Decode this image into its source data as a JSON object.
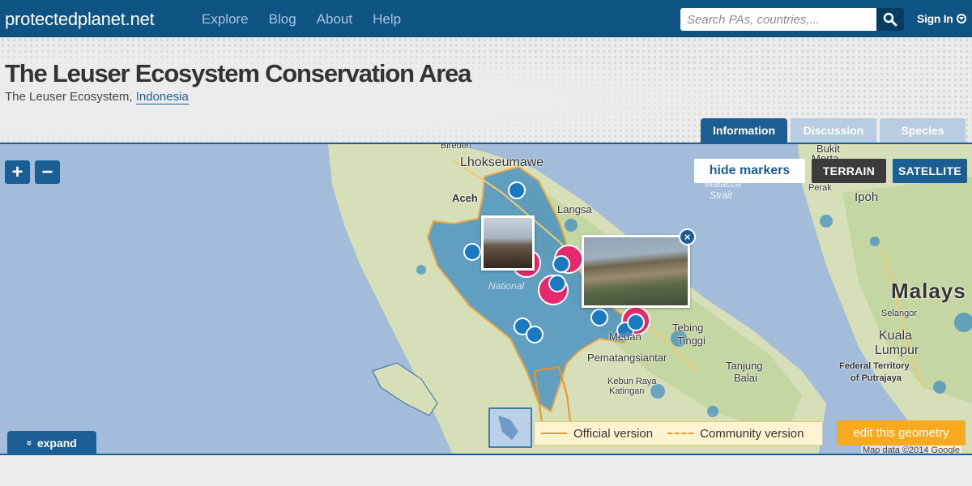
{
  "topbar": {
    "site_name": "protectedplanet.net",
    "nav": [
      "Explore",
      "Blog",
      "About",
      "Help"
    ],
    "search_placeholder": "Search PAs, countries,...",
    "signin_label": "Sign In"
  },
  "header": {
    "title": "The Leuser Ecosystem Conservation Area",
    "subtitle_prefix": "The Leuser Ecosystem, ",
    "country_link": "Indonesia"
  },
  "tabs": [
    {
      "label": "Information",
      "active": true
    },
    {
      "label": "Discussion",
      "active": false
    },
    {
      "label": "Species",
      "active": false
    }
  ],
  "map": {
    "zoom_in": "+",
    "zoom_out": "−",
    "hide_markers": "hide markers",
    "terrain": "TERRAIN",
    "satellite": "SATELLITE",
    "labels": {
      "birden": "Bireuen",
      "lhokseumawe": "Lhokseumawe",
      "aceh": "Aceh",
      "langsa": "Langsa",
      "national": "National",
      "bukit": "Bukit",
      "merta": "Merta",
      "malacca": "Malacca",
      "strait": "Strait",
      "perak": "Perak",
      "ipoh": "Ipoh",
      "malays": "Malays",
      "selangor": "Selangor",
      "kuala": "Kuala",
      "lumpur": "Lumpur",
      "federal1": "Federal Territory",
      "federal2": "of Putrajaya",
      "tebing1": "Tebing",
      "tebing2": "Tinggi",
      "pematang": "Pematangsiantar",
      "tanjung1": "Tanjung",
      "tanjung2": "Balai",
      "kebun1": "Kebun Raya",
      "kebun2": "Katingan",
      "medan": "Medan"
    },
    "close": "×",
    "expand_label": "expand",
    "expand_icon": "»",
    "legend_official": "Official version",
    "legend_community": "Community version",
    "edit_geometry": "edit this geometry",
    "copyright": "Map data ©2014 Google"
  },
  "colors": {
    "nav_bg": "#0d5485",
    "accent": "#1a5e94",
    "orange": "#f39320",
    "pink": "#e6286e"
  }
}
